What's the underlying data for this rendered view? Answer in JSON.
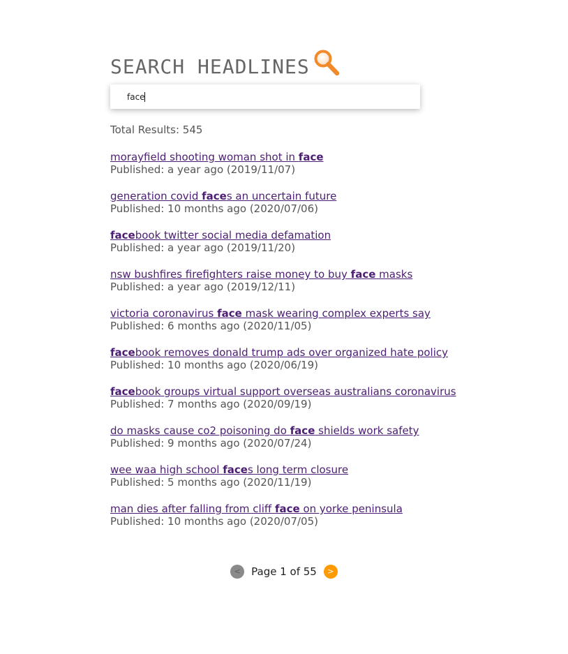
{
  "header": {
    "title": "SEARCH HEADLINES",
    "icon": "search-icon",
    "icon_color": "#f08a2a"
  },
  "search": {
    "value": "face",
    "placeholder": ""
  },
  "total_results": "Total Results: 545",
  "results": [
    {
      "parts": [
        "morayfield shooting woman shot in ",
        "face",
        ""
      ],
      "published": "Published: a year ago (2019/11/07)"
    },
    {
      "parts": [
        "generation covid ",
        "face",
        "s an uncertain future"
      ],
      "published": "Published: 10 months ago (2020/07/06)"
    },
    {
      "parts": [
        "",
        "face",
        "book twitter social media defamation"
      ],
      "published": "Published: a year ago (2019/11/20)"
    },
    {
      "parts": [
        "nsw bushfires firefighters raise money to buy ",
        "face",
        " masks"
      ],
      "published": "Published: a year ago (2019/12/11)"
    },
    {
      "parts": [
        "victoria coronavirus ",
        "face",
        " mask wearing complex experts say"
      ],
      "published": "Published: 6 months ago (2020/11/05)"
    },
    {
      "parts": [
        "",
        "face",
        "book removes donald trump ads over organized hate policy"
      ],
      "published": "Published: 10 months ago (2020/06/19)"
    },
    {
      "parts": [
        "",
        "face",
        "book groups virtual support overseas australians coronavirus"
      ],
      "published": "Published: 7 months ago (2020/09/19)"
    },
    {
      "parts": [
        "do masks cause co2 poisoning do ",
        "face",
        " shields work safety"
      ],
      "published": "Published: 9 months ago (2020/07/24)"
    },
    {
      "parts": [
        "wee waa high school ",
        "face",
        "s long term closure"
      ],
      "published": "Published: 5 months ago (2020/11/19)"
    },
    {
      "parts": [
        "man dies after falling from cliff ",
        "face",
        " on yorke peninsula"
      ],
      "published": "Published: 10 months ago (2020/07/05)"
    }
  ],
  "pagination": {
    "prev_label": "<",
    "next_label": ">",
    "page_text": "Page 1 of 55"
  },
  "colors": {
    "link": "#4b1e73",
    "next_button": "#ff9a00",
    "prev_button": "#8a8a8a"
  }
}
